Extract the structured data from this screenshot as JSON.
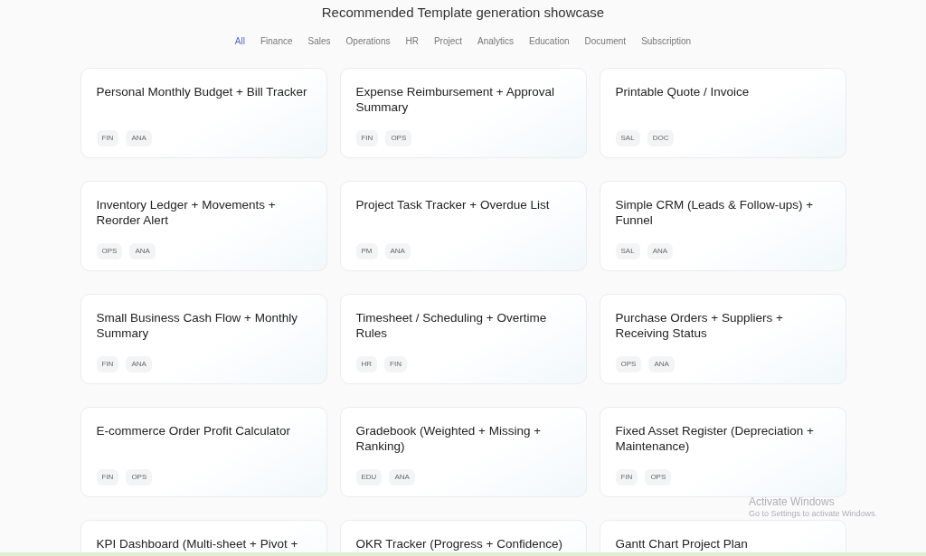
{
  "title": "Recommended Template generation showcase",
  "tabs": [
    {
      "label": "All",
      "selected": true
    },
    {
      "label": "Finance",
      "selected": false
    },
    {
      "label": "Sales",
      "selected": false
    },
    {
      "label": "Operations",
      "selected": false
    },
    {
      "label": "HR",
      "selected": false
    },
    {
      "label": "Project",
      "selected": false
    },
    {
      "label": "Analytics",
      "selected": false
    },
    {
      "label": "Education",
      "selected": false
    },
    {
      "label": "Document",
      "selected": false
    },
    {
      "label": "Subscription",
      "selected": false
    }
  ],
  "cards": [
    {
      "title": "Personal Monthly Budget + Bill Tracker",
      "tags": [
        "FIN",
        "ANA"
      ]
    },
    {
      "title": "Expense Reimbursement + Approval Summary",
      "tags": [
        "FIN",
        "OPS"
      ]
    },
    {
      "title": "Printable Quote / Invoice",
      "tags": [
        "SAL",
        "DOC"
      ]
    },
    {
      "title": "Inventory Ledger + Movements + Reorder Alert",
      "tags": [
        "OPS",
        "ANA"
      ]
    },
    {
      "title": "Project Task Tracker + Overdue List",
      "tags": [
        "PM",
        "ANA"
      ]
    },
    {
      "title": "Simple CRM (Leads & Follow-ups) + Funnel",
      "tags": [
        "SAL",
        "ANA"
      ]
    },
    {
      "title": "Small Business Cash Flow + Monthly Summary",
      "tags": [
        "FIN",
        "ANA"
      ]
    },
    {
      "title": "Timesheet / Scheduling + Overtime Rules",
      "tags": [
        "HR",
        "FIN"
      ]
    },
    {
      "title": "Purchase Orders + Suppliers + Receiving Status",
      "tags": [
        "OPS",
        "ANA"
      ]
    },
    {
      "title": "E-commerce Order Profit Calculator",
      "tags": [
        "FIN",
        "OPS"
      ]
    },
    {
      "title": "Gradebook (Weighted + Missing + Ranking)",
      "tags": [
        "EDU",
        "ANA"
      ]
    },
    {
      "title": "Fixed Asset Register (Depreciation + Maintenance)",
      "tags": [
        "FIN",
        "OPS"
      ]
    },
    {
      "title": "KPI Dashboard (Multi-sheet + Pivot +"
    },
    {
      "title": "OKR Tracker (Progress + Confidence)"
    },
    {
      "title": "Gantt Chart Project Plan"
    }
  ],
  "activation_notice": {
    "heading": "Activate Windows",
    "text": "Go to Settings to activate Windows."
  }
}
